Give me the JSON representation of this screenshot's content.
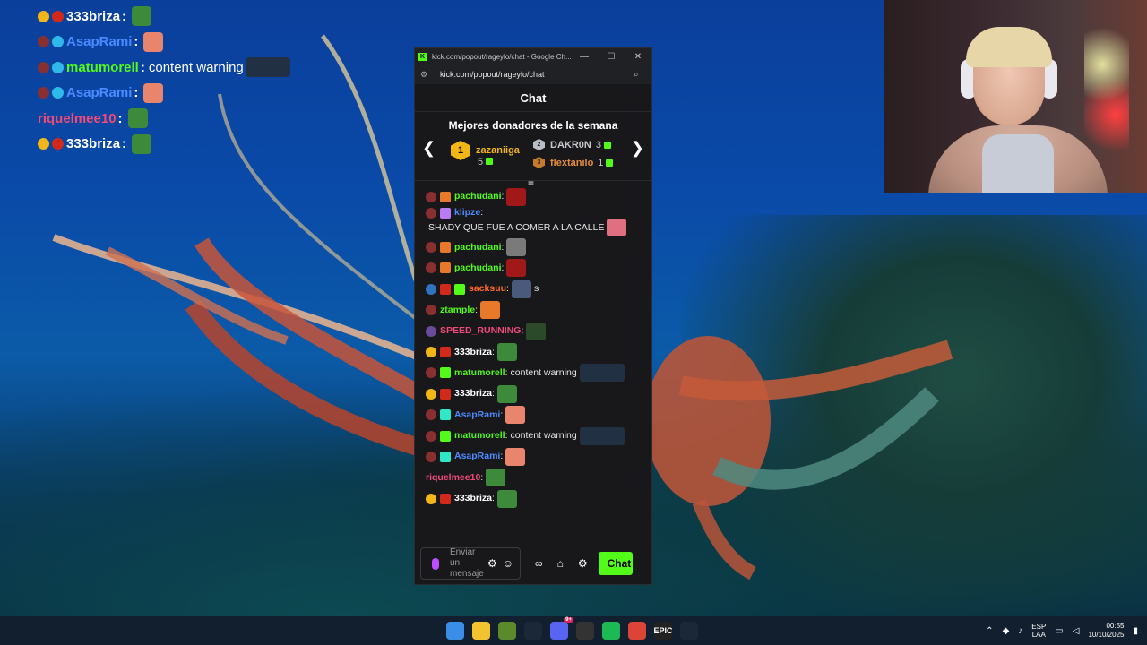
{
  "overlay_chat": [
    {
      "name": "333briza",
      "name_color": "#ffffff",
      "badges": [
        "#f2b616",
        "#d12a1c"
      ],
      "message": "",
      "emote_color": "#3d8a3a"
    },
    {
      "name": "AsapRami",
      "name_color": "#4b8bff",
      "badges": [
        "#8a2f2f",
        "#2fb8e8"
      ],
      "message": "",
      "emote_color": "#e9856c"
    },
    {
      "name": "matumorell",
      "name_color": "#53fc18",
      "badges": [
        "#8a2f2f",
        "#2fb8e8"
      ],
      "message": "content warning",
      "emote_color": "#223044"
    },
    {
      "name": "AsapRami",
      "name_color": "#4b8bff",
      "badges": [
        "#8a2f2f",
        "#2fb8e8"
      ],
      "message": "",
      "emote_color": "#e9856c"
    },
    {
      "name": "riquelmee10",
      "name_color": "#f04a7a",
      "badges": [],
      "message": "",
      "emote_color": "#3d8a3a"
    },
    {
      "name": "333briza",
      "name_color": "#ffffff",
      "badges": [
        "#f2b616",
        "#d12a1c"
      ],
      "message": "",
      "emote_color": "#3d8a3a"
    }
  ],
  "browser": {
    "title": "kick.com/popout/rageylo/chat - Google Ch...",
    "url": "kick.com/popout/rageylo/chat",
    "controls": {
      "minimize": "—",
      "maximize": "☐",
      "close": "✕"
    }
  },
  "chat": {
    "header": "Chat",
    "donors_title": "Mejores donadores de la semana",
    "donors": [
      {
        "rank": "1",
        "name": "zazaniiga",
        "count": "5"
      },
      {
        "rank": "2",
        "name": "DAKR0N",
        "count": "3"
      },
      {
        "rank": "3",
        "name": "flextanilo",
        "count": "1"
      }
    ],
    "messages": [
      {
        "name": "pachudani",
        "color": "#53fc18",
        "badges": [
          "#8a2f2f",
          "#e8792a"
        ],
        "text": "",
        "emote_color": "#a01818"
      },
      {
        "name": "klipze",
        "color": "#4b8bff",
        "badges": [
          "#8a2f2f",
          "#b97cf5"
        ],
        "text": "SHADY QUE FUE A COMER A LA CALLE",
        "emote_color": "#e07080"
      },
      {
        "name": "pachudani",
        "color": "#53fc18",
        "badges": [
          "#8a2f2f",
          "#e8792a"
        ],
        "text": "",
        "emote_color": "#7a7a7a"
      },
      {
        "name": "pachudani",
        "color": "#53fc18",
        "badges": [
          "#8a2f2f",
          "#e8792a"
        ],
        "text": "",
        "emote_color": "#a01818"
      },
      {
        "name": "sacksuu",
        "color": "#ff6a2a",
        "badges": [
          "#2f74c0",
          "#d12a1c",
          "#53fc18"
        ],
        "text": "s",
        "emote_color": "#4a5a7a"
      },
      {
        "name": "ztample",
        "color": "#53fc18",
        "badges": [
          "#8a2f2f"
        ],
        "text": "",
        "emote_color": "#e8792a"
      },
      {
        "name": "SPEED_RUNNING",
        "color": "#f04a7a",
        "badges": [
          "#6a4a9a"
        ],
        "text": "",
        "emote_color": "#2a4a2a"
      },
      {
        "name": "333briza",
        "color": "#ffffff",
        "badges": [
          "#f2b616",
          "#d12a1c"
        ],
        "text": "",
        "emote_color": "#3d8a3a"
      },
      {
        "name": "matumorell",
        "color": "#53fc18",
        "badges": [
          "#8a2f2f",
          "#53fc18"
        ],
        "text": "content warning",
        "emote_color": "#223044"
      },
      {
        "name": "333briza",
        "color": "#ffffff",
        "badges": [
          "#f2b616",
          "#d12a1c"
        ],
        "text": "",
        "emote_color": "#3d8a3a"
      },
      {
        "name": "AsapRami",
        "color": "#4b8bff",
        "badges": [
          "#8a2f2f",
          "#2fe8c8"
        ],
        "text": "",
        "emote_color": "#e9856c"
      },
      {
        "name": "matumorell",
        "color": "#53fc18",
        "badges": [
          "#8a2f2f",
          "#53fc18"
        ],
        "text": "content warning",
        "emote_color": "#223044"
      },
      {
        "name": "AsapRami",
        "color": "#4b8bff",
        "badges": [
          "#8a2f2f",
          "#2fe8c8"
        ],
        "text": "",
        "emote_color": "#e9856c"
      },
      {
        "name": "riquelmee10",
        "color": "#f04a7a",
        "badges": [],
        "text": "",
        "emote_color": "#3d8a3a"
      },
      {
        "name": "333briza",
        "color": "#ffffff",
        "badges": [
          "#f2b616",
          "#d12a1c"
        ],
        "text": "",
        "emote_color": "#3d8a3a"
      }
    ],
    "input_placeholder": "Enviar un mensaje",
    "send_label": "Chat"
  },
  "taskbar": {
    "apps": [
      {
        "name": "windows-start",
        "label": "",
        "color": "#3a8ee8"
      },
      {
        "name": "file-explorer",
        "label": "",
        "color": "#f2c230"
      },
      {
        "name": "app-green",
        "label": "",
        "color": "#5a8a2a"
      },
      {
        "name": "steam",
        "label": "",
        "color": "#1b2838"
      },
      {
        "name": "discord",
        "label": "",
        "color": "#5865f2"
      },
      {
        "name": "obs",
        "label": "",
        "color": "#333333"
      },
      {
        "name": "spotify",
        "label": "",
        "color": "#1db954"
      },
      {
        "name": "chrome",
        "label": "",
        "color": "#db4437"
      },
      {
        "name": "epic-games",
        "label": "EPIC",
        "color": "#222222"
      },
      {
        "name": "steam-2",
        "label": "",
        "color": "#1b2838"
      }
    ],
    "lang_top": "ESP",
    "lang_bottom": "LAA",
    "time": "00:55",
    "date": "10/10/2025",
    "discord_badge": "9+"
  }
}
